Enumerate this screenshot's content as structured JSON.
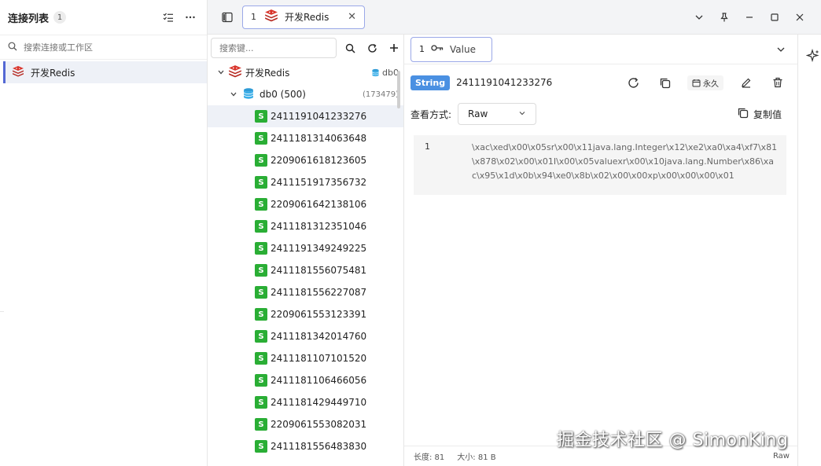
{
  "left_panel": {
    "title": "连接列表",
    "count": "1",
    "search_placeholder": "搜索连接或工作区",
    "connections": [
      {
        "name": "开发Redis"
      }
    ]
  },
  "tab_bar": {
    "tabs": [
      {
        "number": "1",
        "label": "开发Redis"
      }
    ]
  },
  "tree": {
    "search_placeholder": "搜索键...",
    "connection": {
      "name": "开发Redis",
      "db_label": "db0"
    },
    "database": {
      "label": "db0 (500)",
      "count": "(173479)"
    },
    "keys": [
      "2411191041233276",
      "2411181314063648",
      "2209061618123605",
      "2411151917356732",
      "2209061642138106",
      "2411181312351046",
      "2411191349249225",
      "2411181556075481",
      "2411181556227087",
      "2209061553123391",
      "2411181342014760",
      "2411181107101520",
      "2411181106466056",
      "2411181429449710",
      "2209061553082031",
      "2411181556483830"
    ],
    "key_type_letter": "S"
  },
  "value_panel": {
    "tab": {
      "number": "1",
      "label": "Value"
    },
    "type_badge": "String",
    "key_name": "2411191041233276",
    "ttl_label": "永久",
    "view_label": "查看方式:",
    "view_mode": "Raw",
    "copy_label": "复制值",
    "line_number": "1",
    "value_text": "\\xac\\xed\\x00\\x05sr\\x00\\x11java.lang.Integer\\x12\\xe2\\xa0\\xa4\\xf7\\x81\\x878\\x02\\x00\\x01I\\x00\\x05valuexr\\x00\\x10java.lang.Number\\x86\\xac\\x95\\x1d\\x0b\\x94\\xe0\\x8b\\x02\\x00\\x00xp\\x00\\x00\\x00\\x01",
    "status": {
      "length": "长度: 81",
      "size": "大小: 81 B",
      "mode": "Raw"
    }
  },
  "watermark": "掘金技术社区 @ SimonKing",
  "colors": {
    "accent": "#5468d4",
    "string_type": "#2aae35",
    "type_badge": "#4a90e2",
    "redis_red": "#d9342b"
  }
}
